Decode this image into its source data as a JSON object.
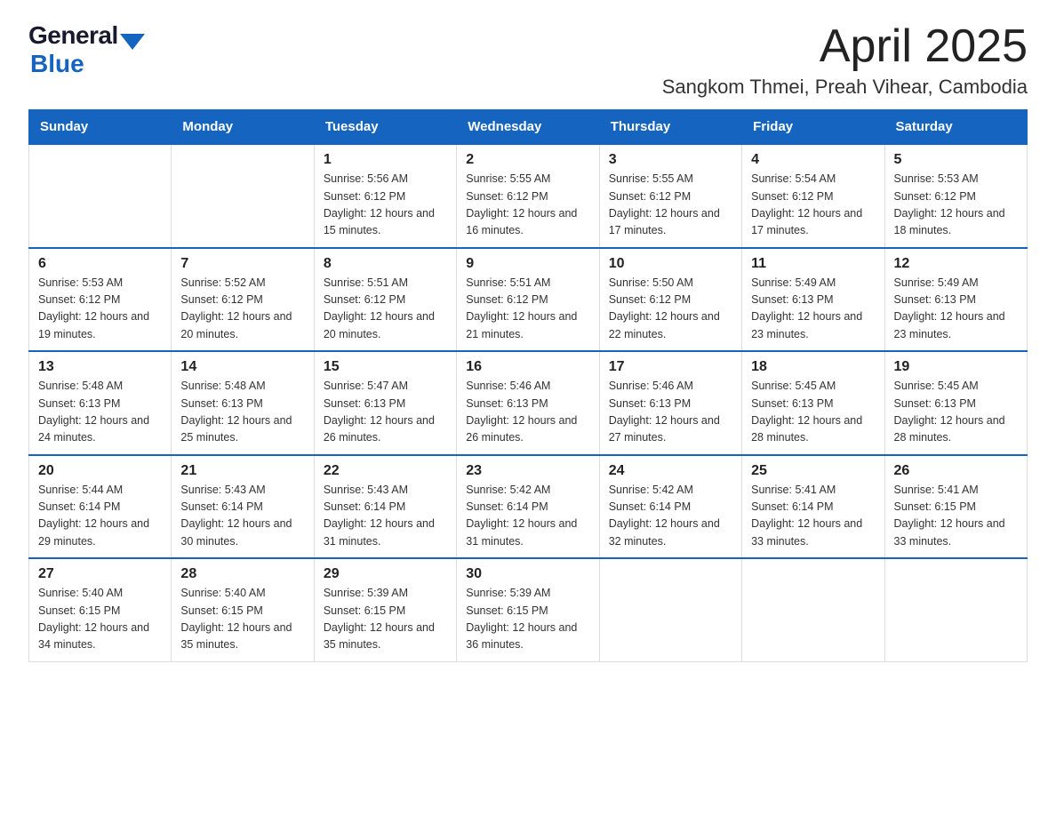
{
  "header": {
    "logo_general": "General",
    "logo_blue": "Blue",
    "month_title": "April 2025",
    "location": "Sangkom Thmei, Preah Vihear, Cambodia"
  },
  "days_of_week": [
    "Sunday",
    "Monday",
    "Tuesday",
    "Wednesday",
    "Thursday",
    "Friday",
    "Saturday"
  ],
  "weeks": [
    [
      {
        "day": "",
        "sunrise": "",
        "sunset": "",
        "daylight": ""
      },
      {
        "day": "",
        "sunrise": "",
        "sunset": "",
        "daylight": ""
      },
      {
        "day": "1",
        "sunrise": "Sunrise: 5:56 AM",
        "sunset": "Sunset: 6:12 PM",
        "daylight": "Daylight: 12 hours and 15 minutes."
      },
      {
        "day": "2",
        "sunrise": "Sunrise: 5:55 AM",
        "sunset": "Sunset: 6:12 PM",
        "daylight": "Daylight: 12 hours and 16 minutes."
      },
      {
        "day": "3",
        "sunrise": "Sunrise: 5:55 AM",
        "sunset": "Sunset: 6:12 PM",
        "daylight": "Daylight: 12 hours and 17 minutes."
      },
      {
        "day": "4",
        "sunrise": "Sunrise: 5:54 AM",
        "sunset": "Sunset: 6:12 PM",
        "daylight": "Daylight: 12 hours and 17 minutes."
      },
      {
        "day": "5",
        "sunrise": "Sunrise: 5:53 AM",
        "sunset": "Sunset: 6:12 PM",
        "daylight": "Daylight: 12 hours and 18 minutes."
      }
    ],
    [
      {
        "day": "6",
        "sunrise": "Sunrise: 5:53 AM",
        "sunset": "Sunset: 6:12 PM",
        "daylight": "Daylight: 12 hours and 19 minutes."
      },
      {
        "day": "7",
        "sunrise": "Sunrise: 5:52 AM",
        "sunset": "Sunset: 6:12 PM",
        "daylight": "Daylight: 12 hours and 20 minutes."
      },
      {
        "day": "8",
        "sunrise": "Sunrise: 5:51 AM",
        "sunset": "Sunset: 6:12 PM",
        "daylight": "Daylight: 12 hours and 20 minutes."
      },
      {
        "day": "9",
        "sunrise": "Sunrise: 5:51 AM",
        "sunset": "Sunset: 6:12 PM",
        "daylight": "Daylight: 12 hours and 21 minutes."
      },
      {
        "day": "10",
        "sunrise": "Sunrise: 5:50 AM",
        "sunset": "Sunset: 6:12 PM",
        "daylight": "Daylight: 12 hours and 22 minutes."
      },
      {
        "day": "11",
        "sunrise": "Sunrise: 5:49 AM",
        "sunset": "Sunset: 6:13 PM",
        "daylight": "Daylight: 12 hours and 23 minutes."
      },
      {
        "day": "12",
        "sunrise": "Sunrise: 5:49 AM",
        "sunset": "Sunset: 6:13 PM",
        "daylight": "Daylight: 12 hours and 23 minutes."
      }
    ],
    [
      {
        "day": "13",
        "sunrise": "Sunrise: 5:48 AM",
        "sunset": "Sunset: 6:13 PM",
        "daylight": "Daylight: 12 hours and 24 minutes."
      },
      {
        "day": "14",
        "sunrise": "Sunrise: 5:48 AM",
        "sunset": "Sunset: 6:13 PM",
        "daylight": "Daylight: 12 hours and 25 minutes."
      },
      {
        "day": "15",
        "sunrise": "Sunrise: 5:47 AM",
        "sunset": "Sunset: 6:13 PM",
        "daylight": "Daylight: 12 hours and 26 minutes."
      },
      {
        "day": "16",
        "sunrise": "Sunrise: 5:46 AM",
        "sunset": "Sunset: 6:13 PM",
        "daylight": "Daylight: 12 hours and 26 minutes."
      },
      {
        "day": "17",
        "sunrise": "Sunrise: 5:46 AM",
        "sunset": "Sunset: 6:13 PM",
        "daylight": "Daylight: 12 hours and 27 minutes."
      },
      {
        "day": "18",
        "sunrise": "Sunrise: 5:45 AM",
        "sunset": "Sunset: 6:13 PM",
        "daylight": "Daylight: 12 hours and 28 minutes."
      },
      {
        "day": "19",
        "sunrise": "Sunrise: 5:45 AM",
        "sunset": "Sunset: 6:13 PM",
        "daylight": "Daylight: 12 hours and 28 minutes."
      }
    ],
    [
      {
        "day": "20",
        "sunrise": "Sunrise: 5:44 AM",
        "sunset": "Sunset: 6:14 PM",
        "daylight": "Daylight: 12 hours and 29 minutes."
      },
      {
        "day": "21",
        "sunrise": "Sunrise: 5:43 AM",
        "sunset": "Sunset: 6:14 PM",
        "daylight": "Daylight: 12 hours and 30 minutes."
      },
      {
        "day": "22",
        "sunrise": "Sunrise: 5:43 AM",
        "sunset": "Sunset: 6:14 PM",
        "daylight": "Daylight: 12 hours and 31 minutes."
      },
      {
        "day": "23",
        "sunrise": "Sunrise: 5:42 AM",
        "sunset": "Sunset: 6:14 PM",
        "daylight": "Daylight: 12 hours and 31 minutes."
      },
      {
        "day": "24",
        "sunrise": "Sunrise: 5:42 AM",
        "sunset": "Sunset: 6:14 PM",
        "daylight": "Daylight: 12 hours and 32 minutes."
      },
      {
        "day": "25",
        "sunrise": "Sunrise: 5:41 AM",
        "sunset": "Sunset: 6:14 PM",
        "daylight": "Daylight: 12 hours and 33 minutes."
      },
      {
        "day": "26",
        "sunrise": "Sunrise: 5:41 AM",
        "sunset": "Sunset: 6:15 PM",
        "daylight": "Daylight: 12 hours and 33 minutes."
      }
    ],
    [
      {
        "day": "27",
        "sunrise": "Sunrise: 5:40 AM",
        "sunset": "Sunset: 6:15 PM",
        "daylight": "Daylight: 12 hours and 34 minutes."
      },
      {
        "day": "28",
        "sunrise": "Sunrise: 5:40 AM",
        "sunset": "Sunset: 6:15 PM",
        "daylight": "Daylight: 12 hours and 35 minutes."
      },
      {
        "day": "29",
        "sunrise": "Sunrise: 5:39 AM",
        "sunset": "Sunset: 6:15 PM",
        "daylight": "Daylight: 12 hours and 35 minutes."
      },
      {
        "day": "30",
        "sunrise": "Sunrise: 5:39 AM",
        "sunset": "Sunset: 6:15 PM",
        "daylight": "Daylight: 12 hours and 36 minutes."
      },
      {
        "day": "",
        "sunrise": "",
        "sunset": "",
        "daylight": ""
      },
      {
        "day": "",
        "sunrise": "",
        "sunset": "",
        "daylight": ""
      },
      {
        "day": "",
        "sunrise": "",
        "sunset": "",
        "daylight": ""
      }
    ]
  ]
}
